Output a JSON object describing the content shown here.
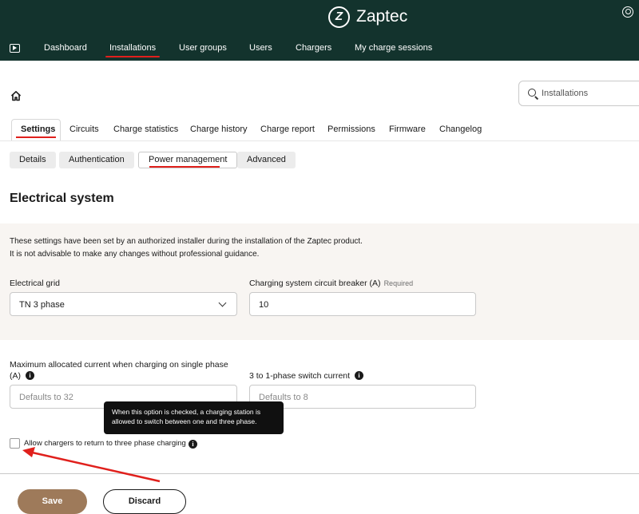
{
  "app": {
    "brand": "Zaptec"
  },
  "nav": {
    "items": [
      {
        "label": "Dashboard"
      },
      {
        "label": "Installations"
      },
      {
        "label": "User groups"
      },
      {
        "label": "Users"
      },
      {
        "label": "Chargers"
      },
      {
        "label": "My charge sessions"
      }
    ],
    "active": "Installations"
  },
  "search": {
    "placeholder": "Installations"
  },
  "tabs": [
    {
      "label": "Settings"
    },
    {
      "label": "Circuits"
    },
    {
      "label": "Charge statistics"
    },
    {
      "label": "Charge history"
    },
    {
      "label": "Charge report"
    },
    {
      "label": "Permissions"
    },
    {
      "label": "Firmware"
    },
    {
      "label": "Changelog"
    }
  ],
  "subtabs": [
    {
      "label": "Details"
    },
    {
      "label": "Authentication"
    },
    {
      "label": "Power management"
    },
    {
      "label": "Advanced"
    }
  ],
  "section": {
    "title": "Electrical system"
  },
  "notice": {
    "line1": "These settings have been set by an authorized installer during the installation of the Zaptec product.",
    "line2": "It is not advisable to make any changes without professional guidance."
  },
  "fields": {
    "grid": {
      "label": "Electrical grid",
      "value": "TN 3 phase"
    },
    "breaker": {
      "label": "Charging system circuit breaker (A)",
      "required": "Required",
      "value": "10"
    },
    "single_phase": {
      "label_line1": "Maximum allocated current when charging on single phase",
      "label_line2": "(A)",
      "placeholder": "Defaults to 32"
    },
    "switch_current": {
      "label": "3 to 1-phase switch current",
      "placeholder": "Defaults to 8"
    }
  },
  "tooltip": {
    "line1": "When this option is checked, a charging station is",
    "line2": "allowed to switch between one and three phase."
  },
  "checkbox": {
    "label": "Allow chargers to return to three phase charging",
    "checked": false
  },
  "actions": {
    "save": "Save",
    "discard": "Discard"
  },
  "colors": {
    "header": "#13332d",
    "accent": "#e0201c",
    "save": "#9e7a5a",
    "panel": "#f8f5f2"
  }
}
